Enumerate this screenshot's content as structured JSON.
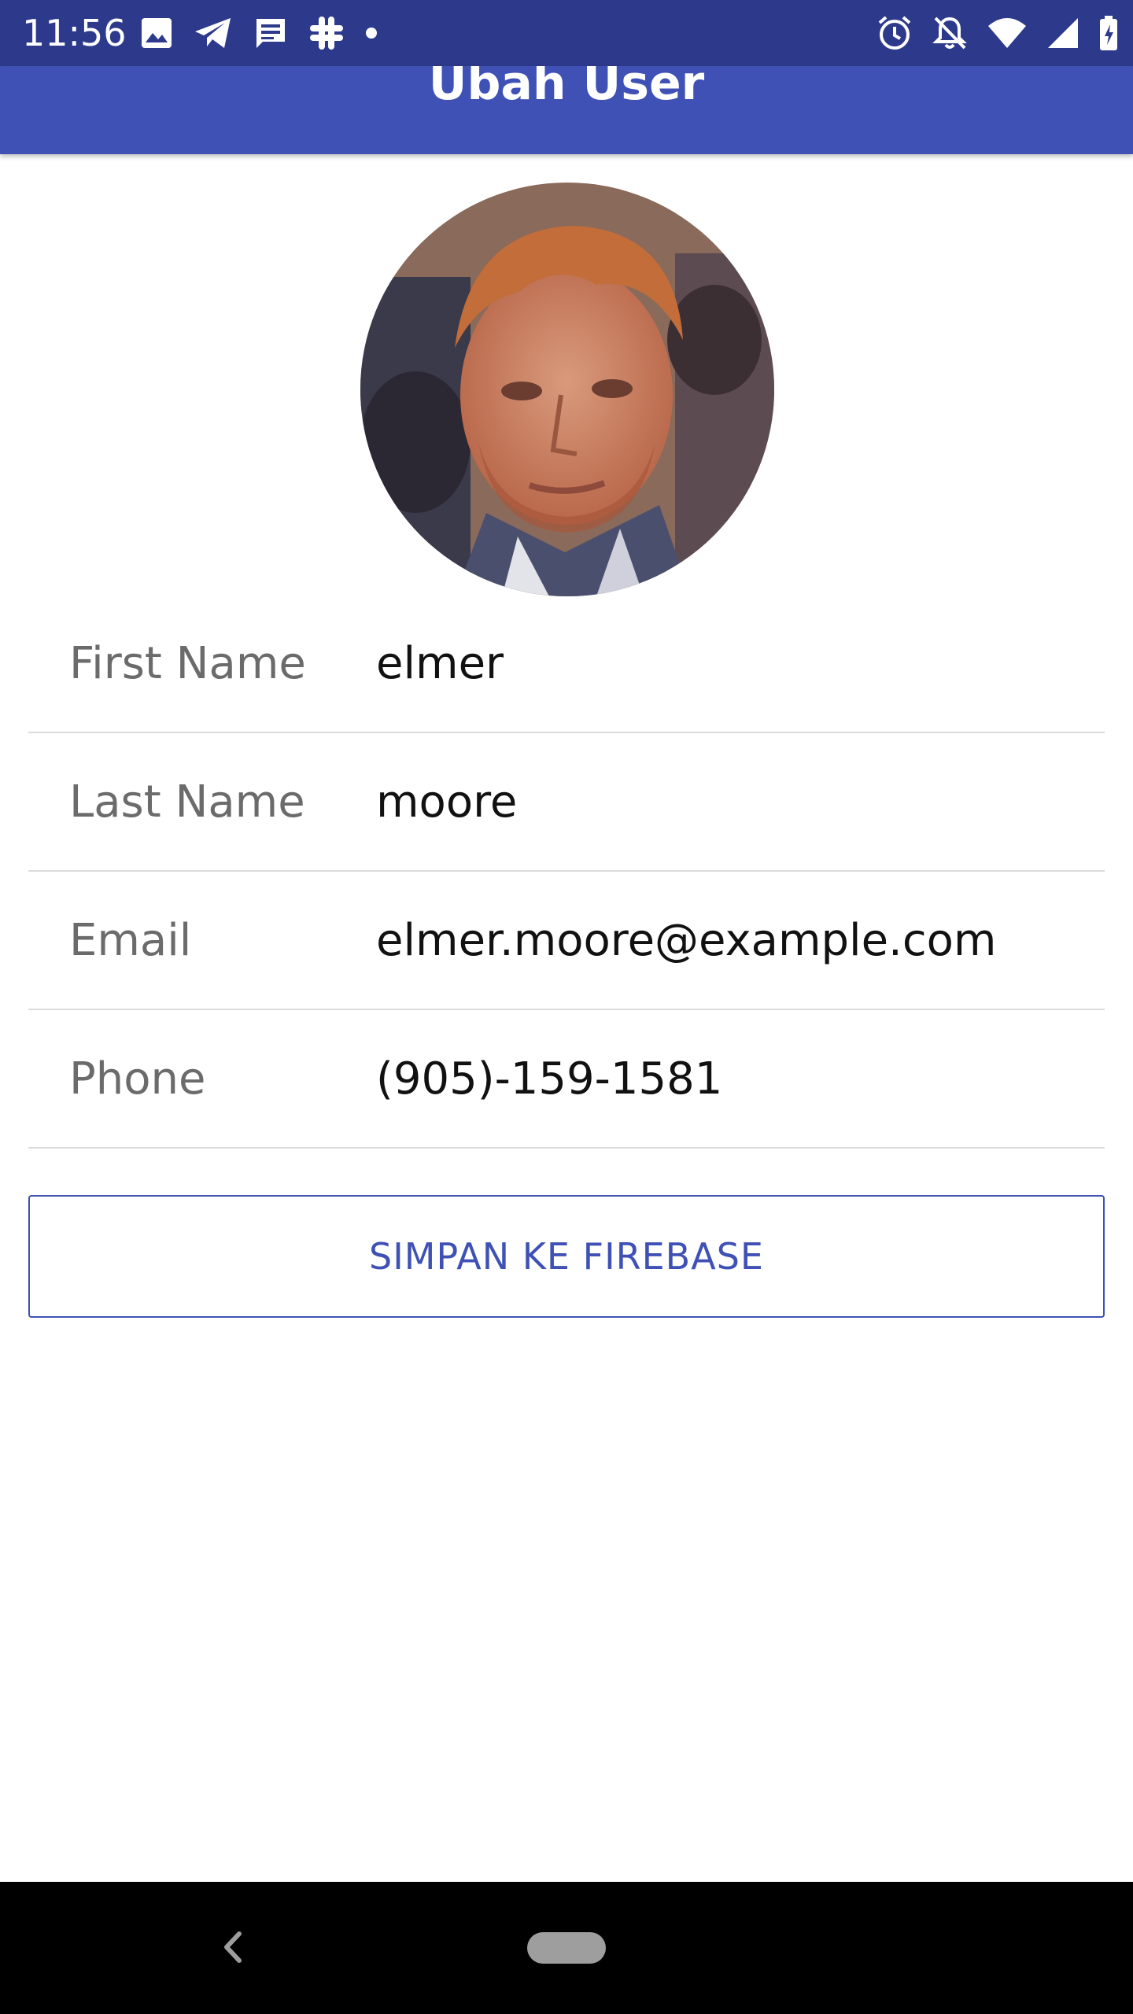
{
  "status_bar": {
    "time": "11:56",
    "left_icons": [
      "image-icon",
      "telegram-icon",
      "message-icon",
      "slack-icon",
      "dot-icon"
    ],
    "right_icons": [
      "alarm-icon",
      "notifications-off-icon",
      "wifi-icon",
      "cellular-icon",
      "battery-charging-icon"
    ]
  },
  "app_bar": {
    "title": "Ubah User",
    "color": "#3f51b5"
  },
  "profile": {
    "avatar_icon": "profile-photo",
    "fields": [
      {
        "label": "First Name",
        "value": "elmer"
      },
      {
        "label": "Last Name",
        "value": "moore"
      },
      {
        "label": "Email",
        "value": "elmer.moore@example.com"
      },
      {
        "label": "Phone",
        "value": "(905)-159-1581"
      }
    ]
  },
  "actions": {
    "save_label": "SIMPAN KE FIREBASE",
    "accent": "#3f51b5"
  },
  "nav_bar": {
    "icons": [
      "back-icon",
      "home-pill-icon"
    ]
  }
}
